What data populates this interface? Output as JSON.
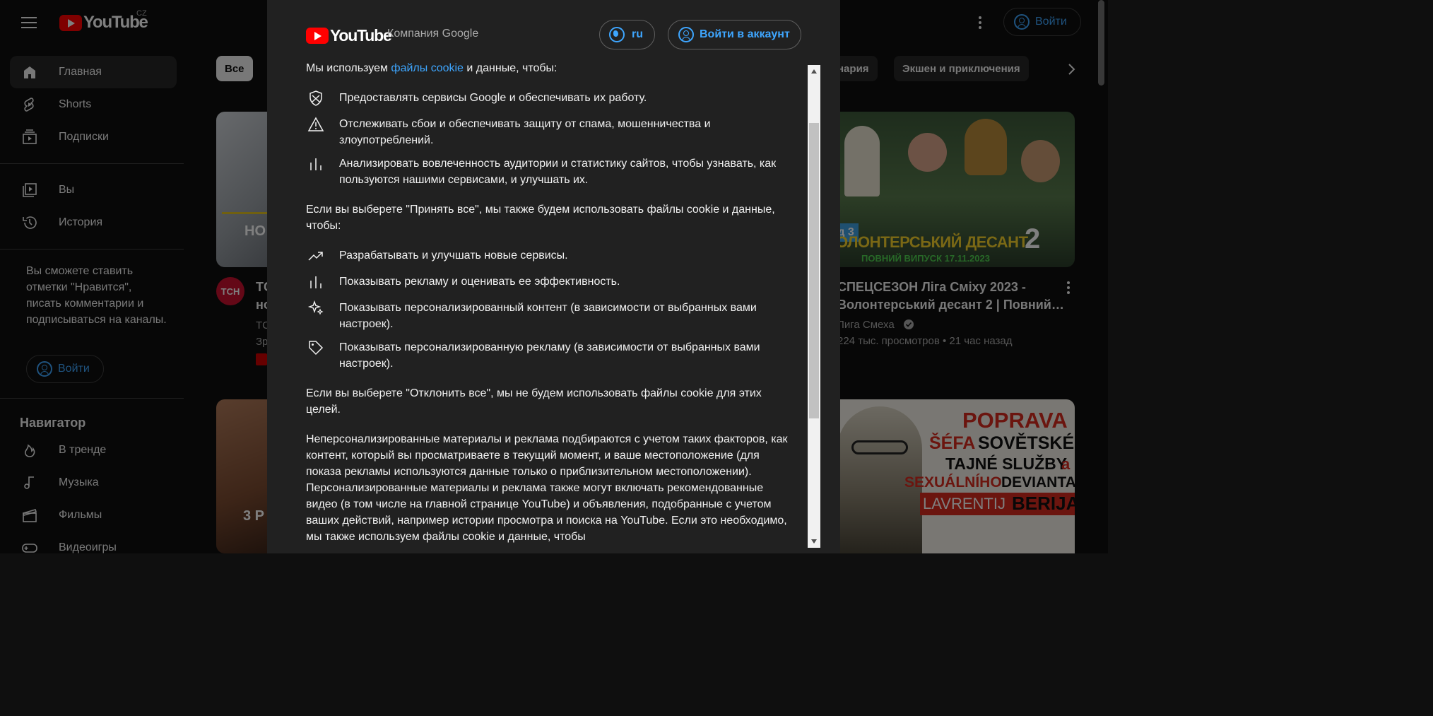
{
  "masthead": {
    "logo_text": "YouTube",
    "region": "CZ",
    "signin": "Войти"
  },
  "sidebar": {
    "items": [
      {
        "label": "Главная",
        "icon": "home-icon"
      },
      {
        "label": "Shorts",
        "icon": "shorts-icon"
      },
      {
        "label": "Подписки",
        "icon": "subscriptions-icon"
      },
      {
        "label": "Вы",
        "icon": "library-icon"
      },
      {
        "label": "История",
        "icon": "history-icon"
      }
    ],
    "note": "Вы сможете ставить отметки \"Нравится\", писать комментарии и подписываться на каналы.",
    "signin": "Войти",
    "navigator_title": "Навигатор",
    "nav_items": [
      {
        "label": "В тренде",
        "icon": "trending-icon"
      },
      {
        "label": "Музыка",
        "icon": "music-icon"
      },
      {
        "label": "Фильмы",
        "icon": "movies-icon"
      },
      {
        "label": "Видеоигры",
        "icon": "gaming-icon"
      }
    ]
  },
  "chips": [
    "Все",
    "нария",
    "Экшен и приключения"
  ],
  "videos": [
    {
      "thumb_text": "НО",
      "channel_avatar": "ТСН",
      "title_part_1": "ТС",
      "title_part_2": "но",
      "meta_1": "ТС",
      "meta_2": "Зр"
    },
    {
      "title_line_1": "СПЕЦСЕЗОН Ліга Сміху 2023 -",
      "title_line_2": "Волонтерський десант 2 | Повний…",
      "channel": "Лига Смеха",
      "meta": "224 тыс. просмотров • 21 час назад",
      "thumb_caption": "ОЛОНТЕРСЬКИЙ ДЕСАНТ",
      "thumb_num": "2",
      "thumb_badge": "д 3",
      "thumb_sub": "ПОВНИЙ ВИПУСК 17.11.2023"
    },
    {
      "thumb_text": "3 Р"
    },
    {
      "poster_lines": [
        "POPRAVA",
        "ŠÉFA",
        "SOVĚTSKÉ",
        "TAJNÉ SLUŽBY",
        "a",
        "SEXUÁLNÍHO",
        "DEVIANTA",
        "LAVRENTIJ",
        "BERIJA"
      ]
    }
  ],
  "dialog": {
    "logo_text": "YouTube",
    "company": "Компания Google",
    "lang": "ru",
    "signin": "Войти в аккаунт",
    "intro_prefix": "Мы используем",
    "intro_link": "файлы cookie",
    "intro_suffix": "и данные, чтобы:",
    "bullets_1": [
      {
        "icon": "shield-icon",
        "text": "Предоставлять сервисы Google и обеспечивать их работу."
      },
      {
        "icon": "warning-icon",
        "text": "Отслеживать сбои и обеспечивать защиту от спама, мошенничества и злоупотреблений."
      },
      {
        "icon": "bar-chart-icon",
        "text": "Анализировать вовлеченность аудитории и статистику сайтов, чтобы узнавать, как пользуются нашими сервисами, и улучшать их."
      }
    ],
    "accept_para": "Если вы выберете \"Принять все\", мы также будем использовать файлы cookie и данные, чтобы:",
    "bullets_2": [
      {
        "icon": "trending-up-icon",
        "text": "Разрабатывать и улучшать новые сервисы."
      },
      {
        "icon": "bar-chart-icon",
        "text": "Показывать рекламу и оценивать ее эффективность."
      },
      {
        "icon": "sparkle-icon",
        "text": "Показывать персонализированный контент (в зависимости от выбранных вами настроек)."
      },
      {
        "icon": "tag-icon",
        "text": "Показывать персонализированную рекламу (в зависимости от выбранных вами настроек)."
      }
    ],
    "reject_para": "Если вы выберете \"Отклонить все\", мы не будем использовать файлы cookie для этих целей.",
    "nonpersonal_para": "Неперсонализированные материалы и реклама подбираются с учетом таких факторов, как контент, который вы просматриваете в текущий момент, и ваше местоположение (для показа рекламы используются данные только о приблизительном местоположении). Персонализированные материалы и реклама также могут включать рекомендованные видео (в том числе на главной странице YouTube) и объявления, подобранные с учетом ваших действий, например истории просмотра и поиска на YouTube. Если это необходимо, мы также используем файлы cookie и данные, чтобы"
  },
  "colors": {
    "accent": "#3ea6ff",
    "brand": "#ff0000",
    "dialog_bg": "#212121",
    "page_bg": "#0f0f0f"
  }
}
